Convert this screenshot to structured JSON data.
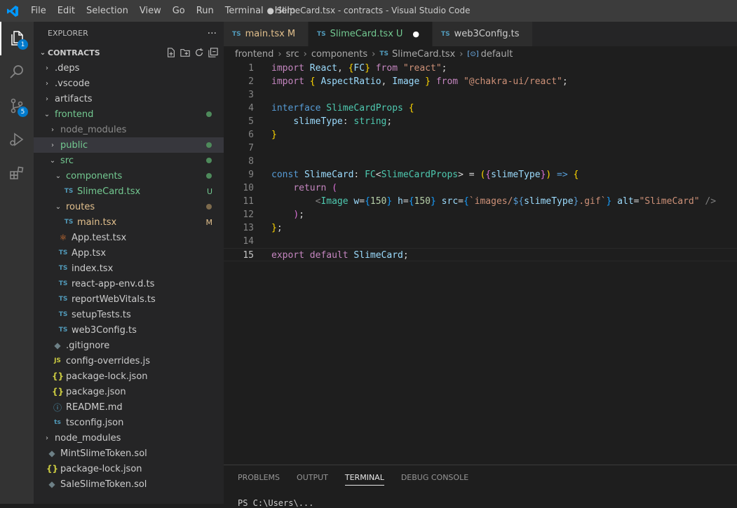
{
  "titlebar": {
    "menu": [
      "File",
      "Edit",
      "Selection",
      "View",
      "Go",
      "Run",
      "Terminal",
      "Help"
    ],
    "title": "● SlimeCard.tsx - contracts - Visual Studio Code"
  },
  "activity": {
    "explorer_badge": "1",
    "scm_badge": "5"
  },
  "sidebar": {
    "header": "EXPLORER",
    "more": "···",
    "section": "CONTRACTS",
    "tree": [
      {
        "label": ".deps",
        "indent": 0,
        "chevron": "›",
        "icon": "",
        "color": "#cccccc"
      },
      {
        "label": ".vscode",
        "indent": 0,
        "chevron": "›",
        "icon": "",
        "color": "#cccccc"
      },
      {
        "label": "artifacts",
        "indent": 0,
        "chevron": "›",
        "icon": "",
        "color": "#cccccc"
      },
      {
        "label": "frontend",
        "indent": 0,
        "chevron": "⌄",
        "icon": "",
        "color": "#73c991",
        "dot": "#4e8a5b"
      },
      {
        "label": "node_modules",
        "indent": 1,
        "chevron": "›",
        "icon": "",
        "color": "#8c8c8c"
      },
      {
        "label": "public",
        "indent": 1,
        "chevron": "›",
        "icon": "",
        "color": "#73c991",
        "dot": "#4e8a5b",
        "selected": true
      },
      {
        "label": "src",
        "indent": 1,
        "chevron": "⌄",
        "icon": "",
        "color": "#73c991",
        "dot": "#4e8a5b"
      },
      {
        "label": "components",
        "indent": 2,
        "chevron": "⌄",
        "icon": "",
        "color": "#73c991",
        "dot": "#4e8a5b"
      },
      {
        "label": "SlimeCard.tsx",
        "indent": 3,
        "chevron": "",
        "icon": "TS",
        "color": "#73c991",
        "status": "U",
        "status_color": "#73c991"
      },
      {
        "label": "routes",
        "indent": 2,
        "chevron": "⌄",
        "icon": "",
        "color": "#e2c08d",
        "dot": "#7d6a4c"
      },
      {
        "label": "main.tsx",
        "indent": 3,
        "chevron": "",
        "icon": "TS",
        "color": "#e2c08d",
        "status": "M",
        "status_color": "#e2c08d"
      },
      {
        "label": "App.test.tsx",
        "indent": 2,
        "chevron": "",
        "icon": "⚛",
        "color": "#cccccc"
      },
      {
        "label": "App.tsx",
        "indent": 2,
        "chevron": "",
        "icon": "TS",
        "color": "#cccccc"
      },
      {
        "label": "index.tsx",
        "indent": 2,
        "chevron": "",
        "icon": "TS",
        "color": "#cccccc"
      },
      {
        "label": "react-app-env.d.ts",
        "indent": 2,
        "chevron": "",
        "icon": "TS",
        "color": "#cccccc"
      },
      {
        "label": "reportWebVitals.ts",
        "indent": 2,
        "chevron": "",
        "icon": "TS",
        "color": "#cccccc"
      },
      {
        "label": "setupTests.ts",
        "indent": 2,
        "chevron": "",
        "icon": "TS",
        "color": "#cccccc"
      },
      {
        "label": "web3Config.ts",
        "indent": 2,
        "chevron": "",
        "icon": "TS",
        "color": "#cccccc"
      },
      {
        "label": ".gitignore",
        "indent": 1,
        "chevron": "",
        "icon": "◆",
        "color": "#cccccc"
      },
      {
        "label": "config-overrides.js",
        "indent": 1,
        "chevron": "",
        "icon": "JS",
        "color": "#cccccc"
      },
      {
        "label": "package-lock.json",
        "indent": 1,
        "chevron": "",
        "icon": "{}",
        "color": "#cccccc"
      },
      {
        "label": "package.json",
        "indent": 1,
        "chevron": "",
        "icon": "{}",
        "color": "#cccccc"
      },
      {
        "label": "README.md",
        "indent": 1,
        "chevron": "",
        "icon": "ⓘ",
        "color": "#cccccc"
      },
      {
        "label": "tsconfig.json",
        "indent": 1,
        "chevron": "",
        "icon": "ts",
        "color": "#cccccc"
      },
      {
        "label": "node_modules",
        "indent": 0,
        "chevron": "›",
        "icon": "",
        "color": "#cccccc"
      },
      {
        "label": "MintSlimeToken.sol",
        "indent": 0,
        "chevron": "",
        "icon": "◆",
        "color": "#cccccc"
      },
      {
        "label": "package-lock.json",
        "indent": 0,
        "chevron": "",
        "icon": "{}",
        "color": "#cccccc"
      },
      {
        "label": "SaleSlimeToken.sol",
        "indent": 0,
        "chevron": "",
        "icon": "◆",
        "color": "#cccccc"
      }
    ]
  },
  "tabs": [
    {
      "label": "main.tsx",
      "suffix": "M",
      "label_color": "#e2c08d",
      "suffix_color": "#e2c08d",
      "active": false
    },
    {
      "label": "SlimeCard.tsx",
      "suffix": "U",
      "label_color": "#73c991",
      "suffix_color": "#73c991",
      "active": true,
      "dirty": "●"
    },
    {
      "label": "web3Config.ts",
      "suffix": "",
      "label_color": "#cccccc",
      "suffix_color": "#cccccc",
      "active": false
    }
  ],
  "breadcrumb": [
    "frontend",
    "src",
    "components",
    "SlimeCard.tsx",
    "default"
  ],
  "code": [
    {
      "n": "1",
      "tokens": [
        [
          "kw2",
          "import "
        ],
        [
          "var",
          "React"
        ],
        [
          "plain",
          ", "
        ],
        [
          "br1",
          "{"
        ],
        [
          "var",
          "FC"
        ],
        [
          "br1",
          "}"
        ],
        [
          "kw2",
          " from "
        ],
        [
          "str",
          "\"react\""
        ],
        [
          "plain",
          ";"
        ]
      ]
    },
    {
      "n": "2",
      "tokens": [
        [
          "kw2",
          "import "
        ],
        [
          "br1",
          "{ "
        ],
        [
          "var",
          "AspectRatio"
        ],
        [
          "plain",
          ", "
        ],
        [
          "var",
          "Image"
        ],
        [
          "br1",
          " }"
        ],
        [
          "kw2",
          " from "
        ],
        [
          "str",
          "\"@chakra-ui/react\""
        ],
        [
          "plain",
          ";"
        ]
      ]
    },
    {
      "n": "3",
      "tokens": []
    },
    {
      "n": "4",
      "tokens": [
        [
          "kw",
          "interface "
        ],
        [
          "typ",
          "SlimeCardProps "
        ],
        [
          "br1",
          "{"
        ]
      ]
    },
    {
      "n": "5",
      "tokens": [
        [
          "plain",
          "    "
        ],
        [
          "var",
          "slimeType"
        ],
        [
          "plain",
          ": "
        ],
        [
          "typ",
          "string"
        ],
        [
          "plain",
          ";"
        ]
      ]
    },
    {
      "n": "6",
      "tokens": [
        [
          "br1",
          "}"
        ]
      ]
    },
    {
      "n": "7",
      "tokens": []
    },
    {
      "n": "8",
      "tokens": []
    },
    {
      "n": "9",
      "tokens": [
        [
          "kw",
          "const "
        ],
        [
          "var",
          "SlimeCard"
        ],
        [
          "plain",
          ": "
        ],
        [
          "typ",
          "FC"
        ],
        [
          "plain",
          "<"
        ],
        [
          "typ",
          "SlimeCardProps"
        ],
        [
          "plain",
          "> = "
        ],
        [
          "br1",
          "("
        ],
        [
          "br2",
          "{"
        ],
        [
          "var",
          "slimeType"
        ],
        [
          "br2",
          "}"
        ],
        [
          "br1",
          ")"
        ],
        [
          "kw",
          " => "
        ],
        [
          "br1",
          "{"
        ]
      ]
    },
    {
      "n": "10",
      "tokens": [
        [
          "plain",
          "    "
        ],
        [
          "kw2",
          "return "
        ],
        [
          "br2",
          "("
        ]
      ]
    },
    {
      "n": "11",
      "tokens": [
        [
          "plain",
          "        "
        ],
        [
          "ang",
          "<"
        ],
        [
          "tag",
          "Image "
        ],
        [
          "var",
          "w"
        ],
        [
          "plain",
          "="
        ],
        [
          "br3",
          "{"
        ],
        [
          "num",
          "150"
        ],
        [
          "br3",
          "}"
        ],
        [
          "var",
          " h"
        ],
        [
          "plain",
          "="
        ],
        [
          "br3",
          "{"
        ],
        [
          "num",
          "150"
        ],
        [
          "br3",
          "}"
        ],
        [
          "var",
          " src"
        ],
        [
          "plain",
          "="
        ],
        [
          "br3",
          "{"
        ],
        [
          "str",
          "`images/"
        ],
        [
          "kw",
          "${"
        ],
        [
          "var",
          "slimeType"
        ],
        [
          "kw",
          "}"
        ],
        [
          "str",
          ".gif`"
        ],
        [
          "br3",
          "}"
        ],
        [
          "var",
          " alt"
        ],
        [
          "plain",
          "="
        ],
        [
          "str",
          "\"SlimeCard\""
        ],
        [
          "ang",
          " />"
        ]
      ]
    },
    {
      "n": "12",
      "tokens": [
        [
          "plain",
          "    "
        ],
        [
          "br2",
          ")"
        ],
        [
          "plain",
          ";"
        ]
      ]
    },
    {
      "n": "13",
      "tokens": [
        [
          "br1",
          "}"
        ],
        [
          "plain",
          ";"
        ]
      ]
    },
    {
      "n": "14",
      "tokens": []
    },
    {
      "n": "15",
      "tokens": [
        [
          "kw2",
          "export "
        ],
        [
          "kw2",
          "default "
        ],
        [
          "var",
          "SlimeCard"
        ],
        [
          "plain",
          ";"
        ]
      ],
      "current": true
    }
  ],
  "panel": {
    "tabs": [
      "PROBLEMS",
      "OUTPUT",
      "TERMINAL",
      "DEBUG CONSOLE"
    ],
    "active": "TERMINAL",
    "terminal_line": "PS C:\\Users\\..."
  }
}
